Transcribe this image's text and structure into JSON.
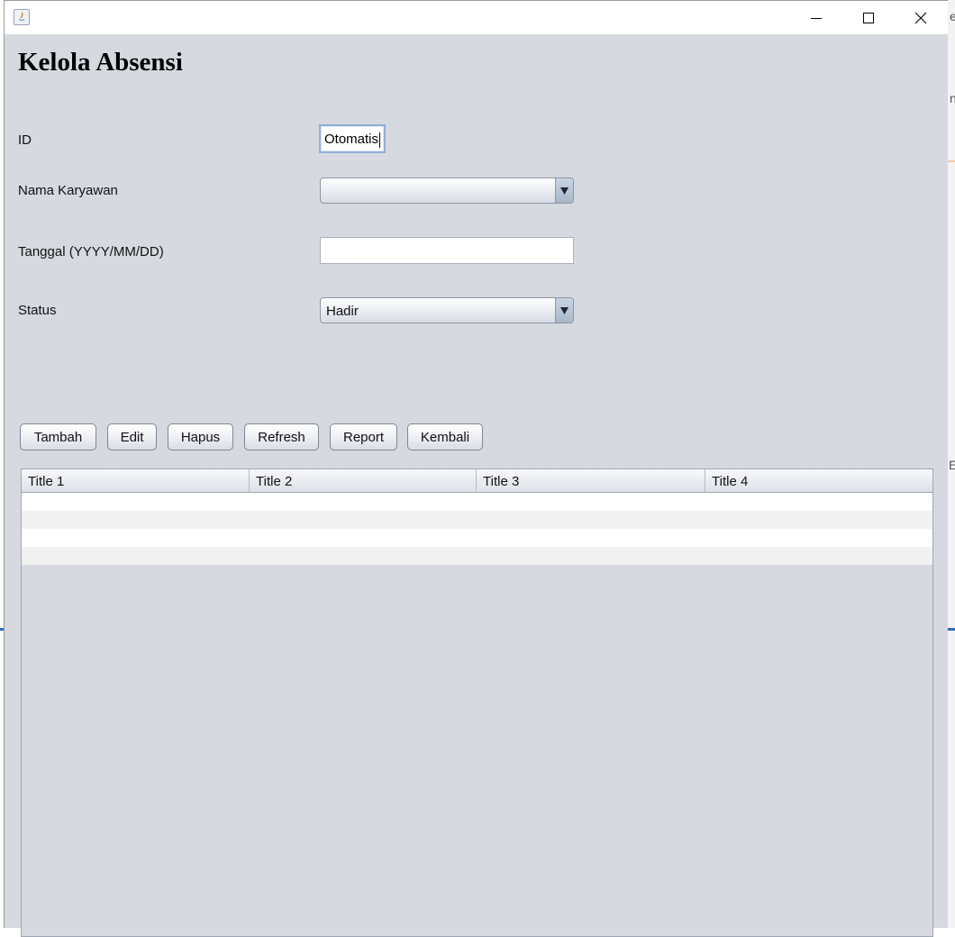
{
  "window": {
    "title": "",
    "controls": [
      "minimize-icon",
      "maximize-icon",
      "close-icon"
    ]
  },
  "background_fragments": {
    "text1": "e",
    "text2": "n",
    "text3": "E"
  },
  "form": {
    "heading": "Kelola Absensi",
    "id_label": "ID",
    "id_value": "Otomatis",
    "nama_label": "Nama Karyawan",
    "nama_value": "",
    "tanggal_label": "Tanggal (YYYY/MM/DD)",
    "tanggal_value": "",
    "status_label": "Status",
    "status_value": "Hadir"
  },
  "buttons": {
    "tambah": "Tambah",
    "edit": "Edit",
    "hapus": "Hapus",
    "refresh": "Refresh",
    "report": "Report",
    "kembali": "Kembali"
  },
  "table": {
    "columns": [
      "Title 1",
      "Title 2",
      "Title 3",
      "Title 4"
    ],
    "rows": [
      [
        "",
        "",
        "",
        ""
      ],
      [
        "",
        "",
        "",
        ""
      ],
      [
        "",
        "",
        "",
        ""
      ],
      [
        "",
        "",
        "",
        ""
      ]
    ]
  },
  "colors": {
    "panel_bg": "#d6d9e0",
    "row_even": "#ffffff",
    "row_odd": "#f1f1f1"
  }
}
